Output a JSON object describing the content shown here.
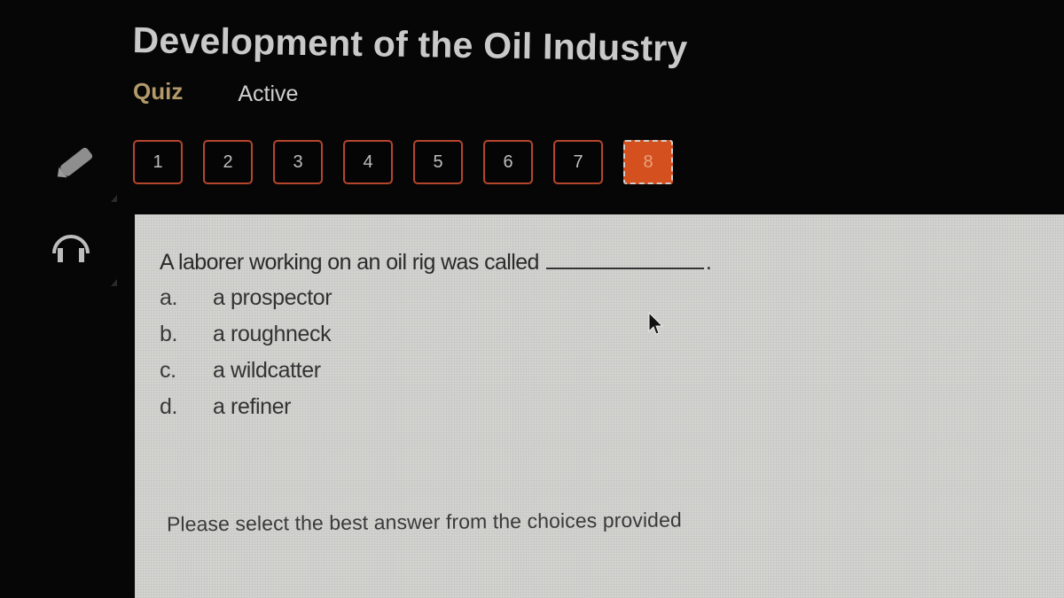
{
  "header": {
    "title": "Development of the Oil Industry",
    "tabs": [
      {
        "label": "Quiz",
        "selected": true
      },
      {
        "label": "Active",
        "selected": false
      }
    ]
  },
  "sidebar": {
    "icons": [
      "pencil-icon",
      "headphones-icon"
    ]
  },
  "question_nav": {
    "items": [
      "1",
      "2",
      "3",
      "4",
      "5",
      "6",
      "7",
      "8"
    ],
    "current": "8",
    "colors": {
      "border": "#b7452e",
      "current_fill": "#d4501e"
    }
  },
  "question": {
    "text": "A laborer working on an oil rig was called",
    "blank_suffix": ".",
    "choices": [
      {
        "letter": "a.",
        "text": "a prospector"
      },
      {
        "letter": "b.",
        "text": "a roughneck"
      },
      {
        "letter": "c.",
        "text": "a wildcatter"
      },
      {
        "letter": "d.",
        "text": "a refiner"
      }
    ]
  },
  "instruction": "Please select the best answer from the choices provided"
}
